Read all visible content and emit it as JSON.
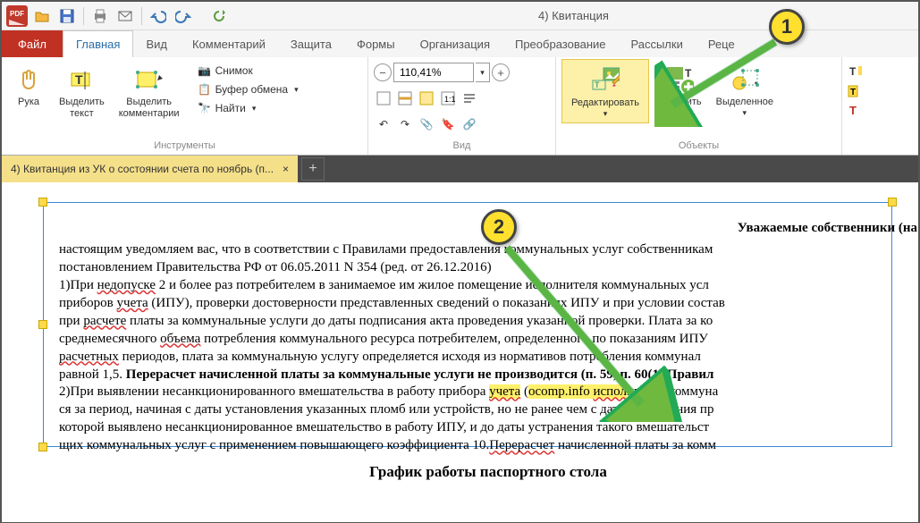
{
  "window_title": "4) Квитанция",
  "tabs": {
    "file": "Файл",
    "items": [
      "Главная",
      "Вид",
      "Комментарий",
      "Защита",
      "Формы",
      "Организация",
      "Преобразование",
      "Рассылки",
      "Реце"
    ],
    "active_index": 0
  },
  "ribbon": {
    "tools": {
      "hand": "Рука",
      "select_text": "Выделить\nтекст",
      "select_comments": "Выделить\nкомментарии",
      "snapshot": "Снимок",
      "clipboard": "Буфер обмена",
      "find": "Найти",
      "group_label": "Инструменты"
    },
    "view": {
      "zoom_value": "110,41%",
      "group_label": "Вид"
    },
    "objects": {
      "edit": "Редактировать",
      "add": "Добавить",
      "selected": "Выделенное",
      "group_label": "Объекты"
    }
  },
  "doc_tab": {
    "title": "4) Квитанция из УК о состоянии счета по ноябрь (п..."
  },
  "document": {
    "header": "Уважаемые собственники (на",
    "line1a": "настоящим уведомляем вас, что в соответствии с Правилами предоставления коммунальных услуг собственникам",
    "line1b": "постановлением Правительства РФ от 06.05.2011 N 354 (ред. от 26.12.2016)",
    "line2a_pre": "1)При ",
    "line2a_u": "недопуске",
    "line2a_post": " 2 и более раз потребителем в занимаемое им жилое помещение исполнителя коммунальных усл",
    "line2b_pre": "приборов ",
    "line2b_u": "учета",
    "line2b_post": " (ИПУ), проверки достоверности представленных сведений о показаниях ИПУ и при условии состав",
    "line2c_pre": "при ",
    "line2c_u": "расчете",
    "line2c_post": " платы за коммунальные услуги до даты подписания акта проведения указанной проверки. Плата за ко",
    "line2d_pre": "среднемесячного ",
    "line2d_u": "объема",
    "line2d_post": " потребления коммунального ресурса потребителем, определенного по показаниям ИПУ ",
    "line2e_pre": "",
    "line2e_u": "расчетных",
    "line2e_post": " периодов, плата за коммунальную услугу определяется исходя из нормативов потребления коммунал",
    "line2f_pre": "равной 1,5. ",
    "line2f_bold": "Перерасчет начисленной платы за коммунальные услуги не производится (п. 59, п. 60(1) Правил",
    "line3a_pre": "2)При выявлении несанкционированного вмешательства в работу прибора ",
    "line3a_hl1": "учета",
    "line3a_mid": " (",
    "line3a_hl2": "ocomp.info",
    "line3a_mid2": " ",
    "line3a_hl3": "испол",
    "line3a_post": "нитель коммуна",
    "line3b": "ся за период, начиная с даты установления указанных пломб или устройств, но не ранее чем с даты проведения пр",
    "line3c": "которой выявлено несанкционированное вмешательство в работу ИПУ, и до даты устранения такого вмешательст",
    "line3d_pre": "щих коммунальных услуг с применением повышающего коэффициента 10.",
    "line3d_u": "Перерасчет",
    "line3d_post": " начисленной платы за комм",
    "footer_heading": "График работы паспортного стола"
  },
  "callouts": {
    "one": "1",
    "two": "2"
  }
}
